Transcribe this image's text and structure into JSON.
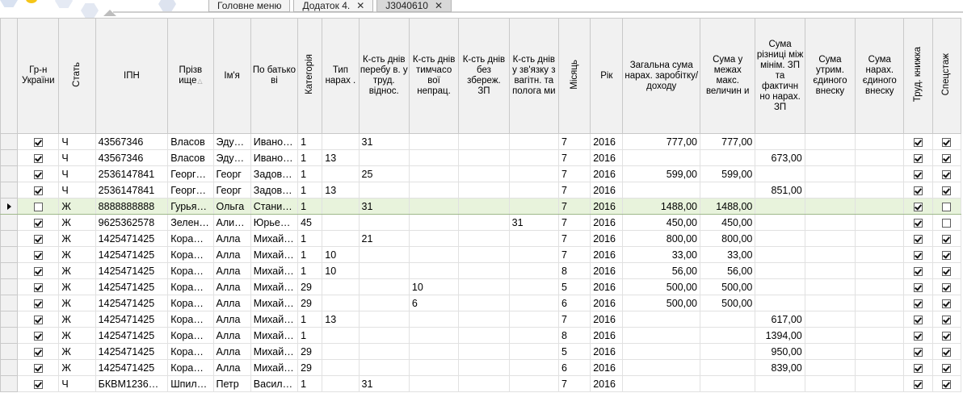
{
  "tabs": [
    {
      "label": "Головне меню",
      "close": "",
      "active": false
    },
    {
      "label": "Додаток 4.",
      "close": "✕",
      "active": false
    },
    {
      "label": "J3040610",
      "close": "✕",
      "active": true
    }
  ],
  "columns": {
    "citizenship": "Гр-н України",
    "sex": "Стать",
    "ipn": "ІПН",
    "surname": "Прізв ище",
    "name": "Ім'я",
    "patronymic": "По батько ві",
    "category": "Категорія",
    "accrual_type": "Тип нарах .",
    "days_labor": "К-сть днів перебу в. у труд. віднос.",
    "days_disability": "К-сть днів тимчасо вої непрац.",
    "days_unpaid": "К-сть днів без збереж. ЗП",
    "days_maternity": "К-сть днів у зв'язку з вагітн. та полога ми",
    "month": "Місяць",
    "year": "Рік",
    "total_income": "Загальна сума нарах. заробітку/ доходу",
    "within_limits": "Сума у межах макс. величин и",
    "min_wage_diff": "Сума різниці між мінім. ЗП та фактичн но нарах. ЗП",
    "withheld_esv": "Сума утрим. єдиного внеску",
    "accrued_esv": "Сума нарах. єдиного внеску",
    "work_book": "Труд. книжка",
    "special_service": "Спецстаж"
  },
  "rows": [
    {
      "selected": false,
      "citizen": true,
      "sex": "Ч",
      "ipn": "43567346",
      "surname": "Власов",
      "name": "Эду…",
      "patronymic": "Ивано…",
      "category": "1",
      "type": "",
      "d1": "31",
      "d2": "",
      "d3": "",
      "d4": "",
      "month": "7",
      "year": "2016",
      "total": "777,00",
      "limits": "777,00",
      "diff": "",
      "withheld": "",
      "accrued": "",
      "book": true,
      "special": true
    },
    {
      "selected": false,
      "citizen": true,
      "sex": "Ч",
      "ipn": "43567346",
      "surname": "Власов",
      "name": "Эду…",
      "patronymic": "Ивано…",
      "category": "1",
      "type": "13",
      "d1": "",
      "d2": "",
      "d3": "",
      "d4": "",
      "month": "7",
      "year": "2016",
      "total": "",
      "limits": "",
      "diff": "673,00",
      "withheld": "",
      "accrued": "",
      "book": true,
      "special": true
    },
    {
      "selected": false,
      "citizen": true,
      "sex": "Ч",
      "ipn": "2536147841",
      "surname": "Георг…",
      "name": "Георг",
      "patronymic": "Задов…",
      "category": "1",
      "type": "",
      "d1": "25",
      "d2": "",
      "d3": "",
      "d4": "",
      "month": "7",
      "year": "2016",
      "total": "599,00",
      "limits": "599,00",
      "diff": "",
      "withheld": "",
      "accrued": "",
      "book": true,
      "special": true
    },
    {
      "selected": false,
      "citizen": true,
      "sex": "Ч",
      "ipn": "2536147841",
      "surname": "Георг…",
      "name": "Георг",
      "patronymic": "Задов…",
      "category": "1",
      "type": "13",
      "d1": "",
      "d2": "",
      "d3": "",
      "d4": "",
      "month": "7",
      "year": "2016",
      "total": "",
      "limits": "",
      "diff": "851,00",
      "withheld": "",
      "accrued": "",
      "book": true,
      "special": true
    },
    {
      "selected": true,
      "citizen": false,
      "sex": "Ж",
      "ipn": "8888888888",
      "surname": "Гурья…",
      "name": "Ольга",
      "patronymic": "Стани…",
      "category": "1",
      "type": "",
      "d1": "31",
      "d2": "",
      "d3": "",
      "d4": "",
      "month": "7",
      "year": "2016",
      "total": "1488,00",
      "limits": "1488,00",
      "diff": "",
      "withheld": "",
      "accrued": "",
      "book": true,
      "special": false
    },
    {
      "selected": false,
      "citizen": true,
      "sex": "Ж",
      "ipn": "9625362578",
      "surname": "Зелен…",
      "name": "Али…",
      "patronymic": "Юрье…",
      "category": "45",
      "type": "",
      "d1": "",
      "d2": "",
      "d3": "",
      "d4": "31",
      "month": "7",
      "year": "2016",
      "total": "450,00",
      "limits": "450,00",
      "diff": "",
      "withheld": "",
      "accrued": "",
      "book": true,
      "special": false
    },
    {
      "selected": false,
      "citizen": true,
      "sex": "Ж",
      "ipn": "1425471425",
      "surname": "Кора…",
      "name": "Алла",
      "patronymic": "Михай…",
      "category": "1",
      "type": "",
      "d1": "21",
      "d2": "",
      "d3": "",
      "d4": "",
      "month": "7",
      "year": "2016",
      "total": "800,00",
      "limits": "800,00",
      "diff": "",
      "withheld": "",
      "accrued": "",
      "book": true,
      "special": true
    },
    {
      "selected": false,
      "citizen": true,
      "sex": "Ж",
      "ipn": "1425471425",
      "surname": "Кора…",
      "name": "Алла",
      "patronymic": "Михай…",
      "category": "1",
      "type": "10",
      "d1": "",
      "d2": "",
      "d3": "",
      "d4": "",
      "month": "7",
      "year": "2016",
      "total": "33,00",
      "limits": "33,00",
      "diff": "",
      "withheld": "",
      "accrued": "",
      "book": true,
      "special": true
    },
    {
      "selected": false,
      "citizen": true,
      "sex": "Ж",
      "ipn": "1425471425",
      "surname": "Кора…",
      "name": "Алла",
      "patronymic": "Михай…",
      "category": "1",
      "type": "10",
      "d1": "",
      "d2": "",
      "d3": "",
      "d4": "",
      "month": "8",
      "year": "2016",
      "total": "56,00",
      "limits": "56,00",
      "diff": "",
      "withheld": "",
      "accrued": "",
      "book": true,
      "special": true
    },
    {
      "selected": false,
      "citizen": true,
      "sex": "Ж",
      "ipn": "1425471425",
      "surname": "Кора…",
      "name": "Алла",
      "patronymic": "Михай…",
      "category": "29",
      "type": "",
      "d1": "",
      "d2": "10",
      "d3": "",
      "d4": "",
      "month": "5",
      "year": "2016",
      "total": "500,00",
      "limits": "500,00",
      "diff": "",
      "withheld": "",
      "accrued": "",
      "book": true,
      "special": true
    },
    {
      "selected": false,
      "citizen": true,
      "sex": "Ж",
      "ipn": "1425471425",
      "surname": "Кора…",
      "name": "Алла",
      "patronymic": "Михай…",
      "category": "29",
      "type": "",
      "d1": "",
      "d2": "6",
      "d3": "",
      "d4": "",
      "month": "6",
      "year": "2016",
      "total": "500,00",
      "limits": "500,00",
      "diff": "",
      "withheld": "",
      "accrued": "",
      "book": true,
      "special": true
    },
    {
      "selected": false,
      "citizen": true,
      "sex": "Ж",
      "ipn": "1425471425",
      "surname": "Кора…",
      "name": "Алла",
      "patronymic": "Михай…",
      "category": "1",
      "type": "13",
      "d1": "",
      "d2": "",
      "d3": "",
      "d4": "",
      "month": "7",
      "year": "2016",
      "total": "",
      "limits": "",
      "diff": "617,00",
      "withheld": "",
      "accrued": "",
      "book": true,
      "special": true
    },
    {
      "selected": false,
      "citizen": true,
      "sex": "Ж",
      "ipn": "1425471425",
      "surname": "Кора…",
      "name": "Алла",
      "patronymic": "Михай…",
      "category": "1",
      "type": "",
      "d1": "",
      "d2": "",
      "d3": "",
      "d4": "",
      "month": "8",
      "year": "2016",
      "total": "",
      "limits": "",
      "diff": "1394,00",
      "withheld": "",
      "accrued": "",
      "book": true,
      "special": true
    },
    {
      "selected": false,
      "citizen": true,
      "sex": "Ж",
      "ipn": "1425471425",
      "surname": "Кора…",
      "name": "Алла",
      "patronymic": "Михай…",
      "category": "29",
      "type": "",
      "d1": "",
      "d2": "",
      "d3": "",
      "d4": "",
      "month": "5",
      "year": "2016",
      "total": "",
      "limits": "",
      "diff": "950,00",
      "withheld": "",
      "accrued": "",
      "book": true,
      "special": true
    },
    {
      "selected": false,
      "citizen": true,
      "sex": "Ж",
      "ipn": "1425471425",
      "surname": "Кора…",
      "name": "Алла",
      "patronymic": "Михай…",
      "category": "29",
      "type": "",
      "d1": "",
      "d2": "",
      "d3": "",
      "d4": "",
      "month": "6",
      "year": "2016",
      "total": "",
      "limits": "",
      "diff": "839,00",
      "withheld": "",
      "accrued": "",
      "book": true,
      "special": true
    },
    {
      "selected": false,
      "citizen": true,
      "sex": "Ч",
      "ipn": "БКВМ1236…",
      "surname": "Шпил…",
      "name": "Петр",
      "patronymic": "Васил…",
      "category": "1",
      "type": "",
      "d1": "31",
      "d2": "",
      "d3": "",
      "d4": "",
      "month": "7",
      "year": "2016",
      "total": "",
      "limits": "",
      "diff": "",
      "withheld": "",
      "accrued": "",
      "book": true,
      "special": true
    }
  ],
  "icons": {
    "sort": "sort-triangle-icon",
    "row_indicator": "row-pointer-icon",
    "close": "close-icon"
  },
  "colors": {
    "header_bg": "#f1f1f1",
    "selected_row": "#e8f3dc",
    "grid_line": "#e1e1e1",
    "logo_accent": "#f5c518"
  }
}
